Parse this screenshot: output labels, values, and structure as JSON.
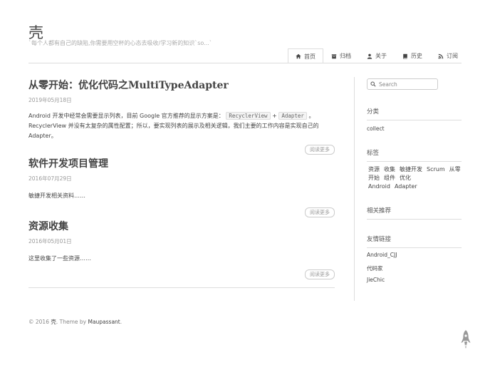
{
  "site": {
    "title": "壳",
    "description": "`每个人都有自己的缺陷,你需要用空杯的心态去吸收/学习新的知识`so...`"
  },
  "nav": [
    {
      "label": "首页",
      "icon": "home-icon",
      "active": true
    },
    {
      "label": "归档",
      "icon": "archive-icon",
      "active": false
    },
    {
      "label": "关于",
      "icon": "user-icon",
      "active": false
    },
    {
      "label": "历史",
      "icon": "book-icon",
      "active": false
    },
    {
      "label": "订阅",
      "icon": "rss-icon",
      "active": false
    }
  ],
  "posts": [
    {
      "title": "从零开始：优化代码之MultiTypeAdapter",
      "date": "2019年05月18日",
      "excerpt_part1": "Android 开发中经常会需要显示列表，目前 Google 官方推荐的显示方案是：",
      "code1": "RecyclerView",
      "plus": "+",
      "code2": "Adapter",
      "excerpt_part2": "。RecyclerView 并没有太复杂的属性配置；所以，要实现列表的展示及相关逻辑，我们主要的工作内容是实现自己的 Adapter。",
      "read_more": "阅读更多"
    },
    {
      "title": "软件开发项目管理",
      "date": "2016年07月29日",
      "excerpt": "敏捷开发相关资料……",
      "read_more": "阅读更多"
    },
    {
      "title": "资源收集",
      "date": "2016年05月01日",
      "excerpt": "这里收集了一些资源……",
      "read_more": "阅读更多"
    }
  ],
  "sidebar": {
    "search_placeholder": "Search",
    "categories_heading": "分类",
    "categories": [
      "collect"
    ],
    "tags_heading": "标签",
    "tags": [
      "资源",
      "收集",
      "敏捷开发",
      "Scrum",
      "从零开始",
      "组件",
      "优化",
      "Android",
      "Adapter"
    ],
    "related_heading": "相关推荐",
    "links_heading": "友情链接",
    "links": [
      "Android_CJJ",
      "代码家",
      "JieChic"
    ]
  },
  "footer": {
    "prefix": "© 2016 ",
    "site_link": "壳",
    "middle": ". Theme by ",
    "theme_link": "Maupassant",
    "suffix": "."
  },
  "colors": {
    "text": "#444444",
    "muted": "#999999",
    "rule": "#dddddd"
  }
}
